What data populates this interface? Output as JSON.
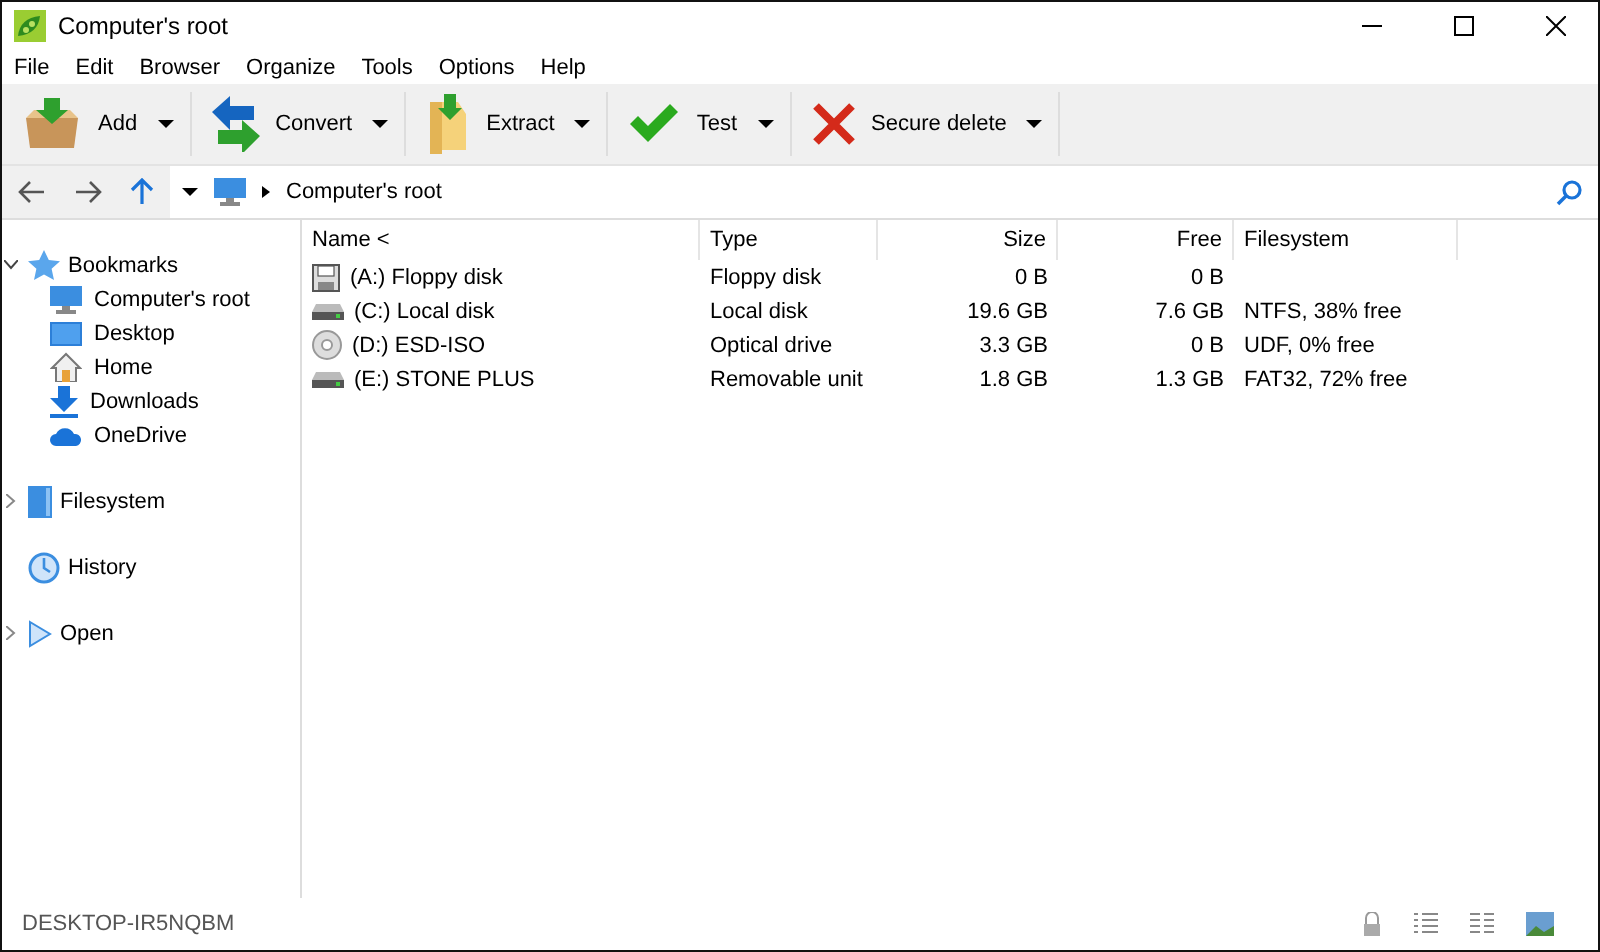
{
  "window": {
    "title": "Computer's root"
  },
  "menu": [
    "File",
    "Edit",
    "Browser",
    "Organize",
    "Tools",
    "Options",
    "Help"
  ],
  "toolbar": [
    {
      "label": "Add",
      "kind": "add"
    },
    {
      "label": "Convert",
      "kind": "convert"
    },
    {
      "label": "Extract",
      "kind": "extract"
    },
    {
      "label": "Test",
      "kind": "test"
    },
    {
      "label": "Secure delete",
      "kind": "delete"
    }
  ],
  "address": {
    "path": "Computer's root"
  },
  "sidebar": [
    {
      "label": "Bookmarks",
      "kind": "star",
      "expanded": true,
      "children": [
        {
          "label": "Computer's root",
          "kind": "monitor"
        },
        {
          "label": "Desktop",
          "kind": "desktop"
        },
        {
          "label": "Home",
          "kind": "home"
        },
        {
          "label": "Downloads",
          "kind": "download"
        },
        {
          "label": "OneDrive",
          "kind": "cloud"
        }
      ]
    },
    {
      "label": "Filesystem",
      "kind": "disk",
      "expanded": false
    },
    {
      "label": "History",
      "kind": "clock"
    },
    {
      "label": "Open",
      "kind": "play",
      "expanded": false
    }
  ],
  "table": {
    "columns": [
      "Name <",
      "Type",
      "Size",
      "Free",
      "Filesystem"
    ],
    "rows": [
      {
        "kind": "floppy",
        "cells": [
          "(A:) Floppy disk",
          "Floppy disk",
          "0 B",
          "0 B",
          ""
        ]
      },
      {
        "kind": "drive",
        "cells": [
          "(C:) Local disk",
          "Local disk",
          "19.6 GB",
          "7.6 GB",
          "NTFS, 38% free"
        ]
      },
      {
        "kind": "optical",
        "cells": [
          "(D:) ESD-ISO",
          "Optical drive",
          "3.3 GB",
          "0 B",
          "UDF, 0% free"
        ]
      },
      {
        "kind": "drive",
        "cells": [
          "(E:) STONE PLUS",
          "Removable unit",
          "1.8 GB",
          "1.3 GB",
          "FAT32, 72% free"
        ]
      }
    ]
  },
  "status_bar": {
    "text": "DESKTOP-IR5NQBM"
  }
}
